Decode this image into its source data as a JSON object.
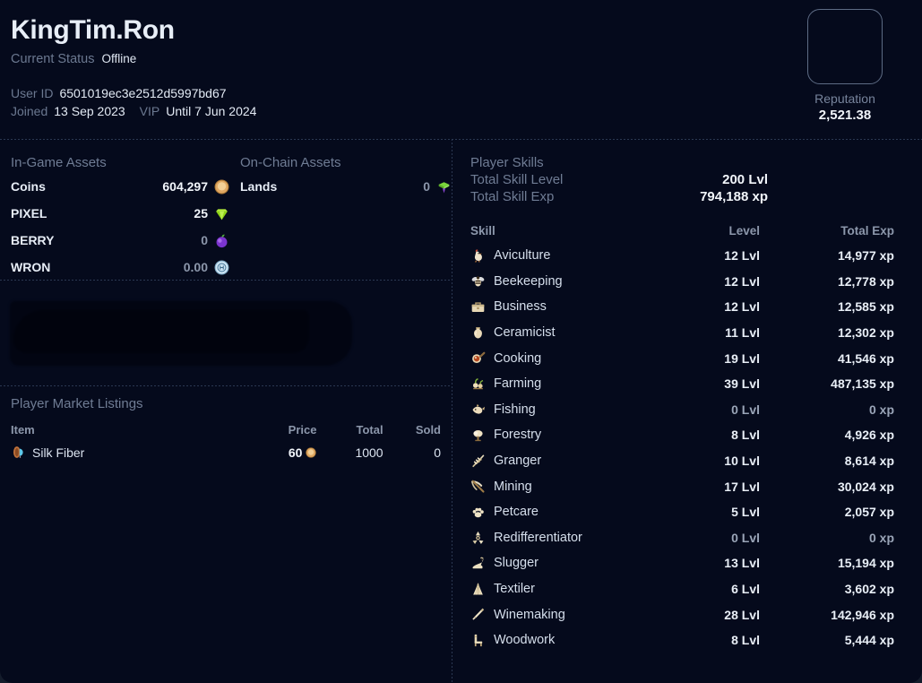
{
  "profile": {
    "username": "KingTim.Ron",
    "status_label": "Current Status",
    "status_value": "Offline",
    "user_id_label": "User ID",
    "user_id_value": "6501019ec3e2512d5997bd67",
    "joined_label": "Joined",
    "joined_value": "13 Sep 2023",
    "vip_label": "VIP",
    "vip_value": "Until 7 Jun 2024",
    "reputation_label": "Reputation",
    "reputation_value": "2,521.38",
    "avatar_icon": "avatar-placeholder"
  },
  "in_game_assets": {
    "title": "In-Game Assets",
    "rows": [
      {
        "name": "Coins",
        "value": "604,297",
        "icon": "gold-coin-icon",
        "dim": false
      },
      {
        "name": "PIXEL",
        "value": "25",
        "icon": "green-gem-icon",
        "dim": false
      },
      {
        "name": "BERRY",
        "value": "0",
        "icon": "purple-berry-icon",
        "dim": true
      },
      {
        "name": "WRON",
        "value": "0.00",
        "icon": "wron-token-icon",
        "dim": true
      }
    ]
  },
  "on_chain_assets": {
    "title": "On-Chain Assets",
    "rows": [
      {
        "name": "Lands",
        "value": "0",
        "icon": "land-plot-icon",
        "dim": true
      }
    ]
  },
  "market": {
    "title": "Player Market Listings",
    "columns": {
      "item": "Item",
      "price": "Price",
      "total": "Total",
      "sold": "Sold"
    },
    "rows": [
      {
        "item": "Silk Fiber",
        "icon": "silk-fiber-icon",
        "price": "60",
        "price_icon": "gold-coin-icon",
        "total": "1000",
        "sold": "0"
      }
    ]
  },
  "skills": {
    "title": "Player Skills",
    "total_level_label": "Total Skill Level",
    "total_level_value": "200 Lvl",
    "total_exp_label": "Total Skill Exp",
    "total_exp_value": "794,188 xp",
    "columns": {
      "skill": "Skill",
      "level": "Level",
      "exp": "Total Exp"
    },
    "rows": [
      {
        "name": "Aviculture",
        "icon": "chicken-icon",
        "level": "12 Lvl",
        "exp": "14,977 xp"
      },
      {
        "name": "Beekeeping",
        "icon": "bee-icon",
        "level": "12 Lvl",
        "exp": "12,778 xp"
      },
      {
        "name": "Business",
        "icon": "briefcase-icon",
        "level": "12 Lvl",
        "exp": "12,585 xp"
      },
      {
        "name": "Ceramicist",
        "icon": "vase-icon",
        "level": "11 Lvl",
        "exp": "12,302 xp"
      },
      {
        "name": "Cooking",
        "icon": "frying-pan-icon",
        "level": "19 Lvl",
        "exp": "41,546 xp"
      },
      {
        "name": "Farming",
        "icon": "crops-icon",
        "level": "39 Lvl",
        "exp": "487,135 xp"
      },
      {
        "name": "Fishing",
        "icon": "fish-icon",
        "level": "0 Lvl",
        "exp": "0 xp"
      },
      {
        "name": "Forestry",
        "icon": "tree-icon",
        "level": "8 Lvl",
        "exp": "4,926 xp"
      },
      {
        "name": "Granger",
        "icon": "wheat-icon",
        "level": "10 Lvl",
        "exp": "8,614 xp"
      },
      {
        "name": "Mining",
        "icon": "pickaxe-icon",
        "level": "17 Lvl",
        "exp": "30,024 xp"
      },
      {
        "name": "Petcare",
        "icon": "paw-icon",
        "level": "5 Lvl",
        "exp": "2,057 xp"
      },
      {
        "name": "Redifferentiator",
        "icon": "recycle-icon",
        "level": "0 Lvl",
        "exp": "0 xp"
      },
      {
        "name": "Slugger",
        "icon": "slug-icon",
        "level": "13 Lvl",
        "exp": "15,194 xp"
      },
      {
        "name": "Textiler",
        "icon": "cloth-icon",
        "level": "6 Lvl",
        "exp": "3,602 xp"
      },
      {
        "name": "Winemaking",
        "icon": "wine-bottle-icon",
        "level": "28 Lvl",
        "exp": "142,946 xp"
      },
      {
        "name": "Woodwork",
        "icon": "chair-icon",
        "level": "8 Lvl",
        "exp": "5,444 xp"
      }
    ]
  },
  "colors": {
    "background": "#050a1c",
    "label": "#6f7c94",
    "value": "#f2f6fb",
    "divider": "#2b3852",
    "coin": "#e8b06a",
    "gem": "#9ede2a",
    "berry": "#8b46d6",
    "land": "#7ad63a"
  }
}
